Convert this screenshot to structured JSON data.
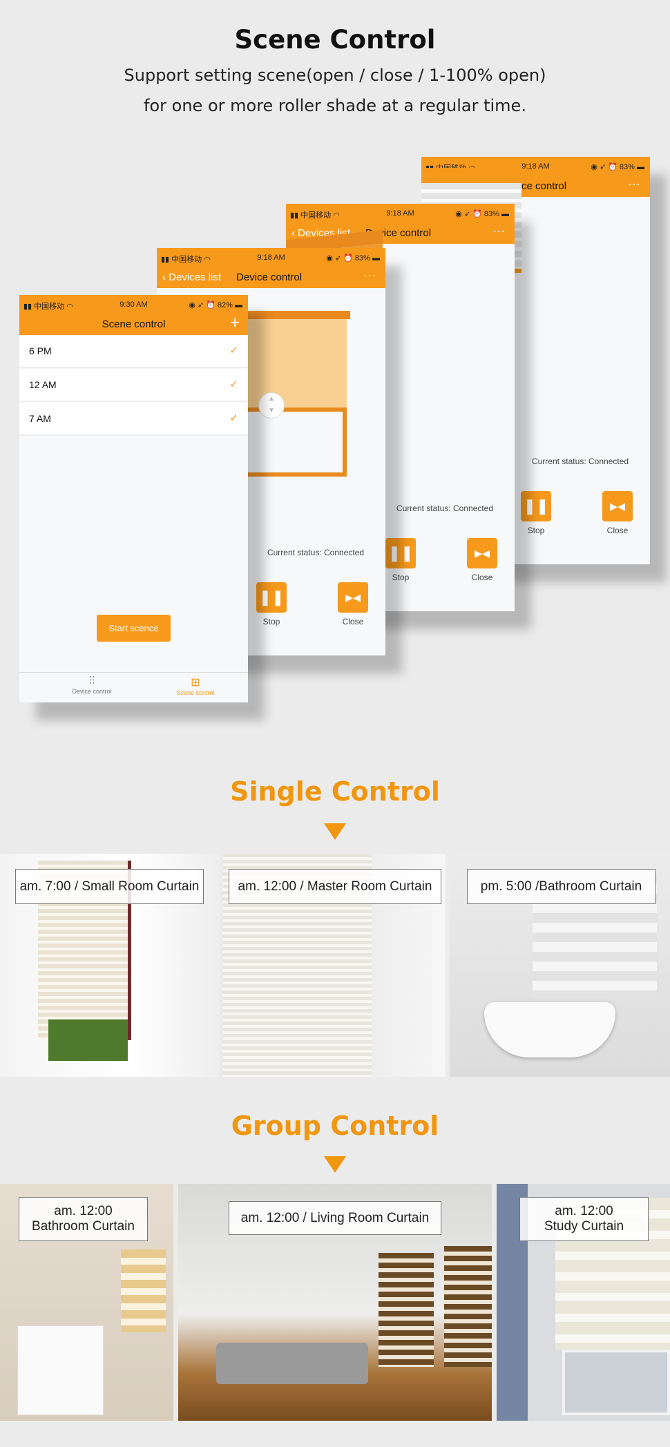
{
  "header": {
    "title": "Scene Control",
    "subtitle_line1": "Support setting scene(open / close / 1-100% open)",
    "subtitle_line2": "for one or more roller shade at a regular time."
  },
  "scene_phone": {
    "carrier": "中国移动",
    "time": "9:30 AM",
    "battery": "82%",
    "title": "Scene control",
    "add": "+",
    "rows": [
      {
        "label": "6 PM",
        "check": "✓"
      },
      {
        "label": "12 AM",
        "check": "✓"
      },
      {
        "label": "7  AM",
        "check": "✓"
      }
    ],
    "start_button": "Start scence",
    "tabs": [
      {
        "label": "Device control"
      },
      {
        "label": "Scene control",
        "active": true
      }
    ]
  },
  "device_phones": [
    {
      "carrier": "中国移动",
      "time": "9:18 AM",
      "battery": "83%",
      "back": "Devices list",
      "title": "Device control",
      "more": "···",
      "status": "Current status: Connected",
      "stop": "Stop",
      "close": "Close",
      "shade": "roller"
    },
    {
      "carrier": "中国移动",
      "time": "9:18 AM",
      "battery": "83%",
      "back": "Devices list",
      "title": "Device control",
      "more": "···",
      "status": "Current status: Connected",
      "stop": "Stop",
      "close": "Close",
      "shade": "zebra"
    },
    {
      "carrier": "中国移动",
      "time": "9:18 AM",
      "battery": "83%",
      "back": "Devices list",
      "title": "Device control",
      "more": "···",
      "status": "Current status: Connected",
      "stop": "Stop",
      "close": "Close",
      "shade": "venetian"
    }
  ],
  "single": {
    "title": "Single Control",
    "photos": [
      {
        "label": "am. 7:00 / Small Room Curtain"
      },
      {
        "label": "am. 12:00 / Master Room Curtain"
      },
      {
        "label": "pm. 5:00 /Bathroom Curtain"
      }
    ]
  },
  "group": {
    "title": "Group Control",
    "photos": [
      {
        "label1": "am. 12:00",
        "label2": "Bathroom Curtain"
      },
      {
        "label1": "am. 12:00 / Living Room Curtain"
      },
      {
        "label1": "am. 12:00",
        "label2": "Study Curtain"
      }
    ]
  },
  "colors": {
    "accent": "#f7991b",
    "heading": "#f0960f",
    "background": "#ebebeb"
  }
}
